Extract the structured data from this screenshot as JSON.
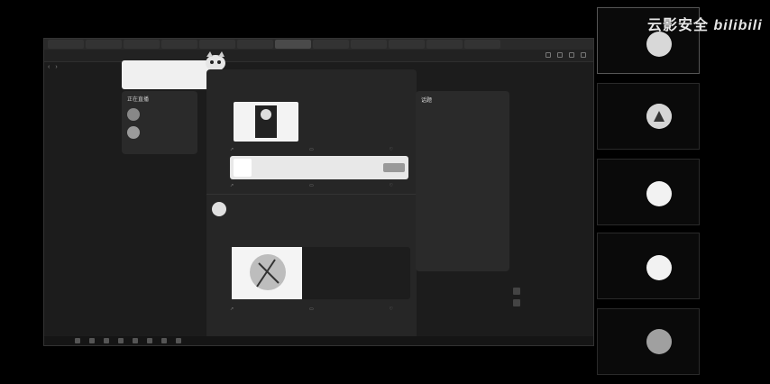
{
  "browser": {
    "tabs": [
      "",
      "",
      "",
      "",
      "",
      "",
      "",
      "",
      "",
      "",
      "",
      "",
      "",
      "",
      ""
    ],
    "tab_tooltip": ""
  },
  "search": {
    "lines": [
      "",
      ""
    ]
  },
  "follow": {
    "title": "正在直播",
    "more": "",
    "items": [
      {
        "name": "",
        "sub": ""
      },
      {
        "name": "",
        "sub": ""
      }
    ]
  },
  "feed": {
    "post1": {
      "meta": "",
      "title": "",
      "text": ""
    },
    "post2": {
      "author": "",
      "time": "",
      "text": ""
    },
    "post3": {
      "author": "",
      "text": ""
    }
  },
  "topics": {
    "title": "话题",
    "items": [
      {
        "name": "",
        "sub": ""
      },
      {
        "name": "",
        "sub": ""
      },
      {
        "name": "",
        "sub": ""
      },
      {
        "name": "",
        "sub": ""
      },
      {
        "name": "",
        "sub": ""
      },
      {
        "name": "",
        "sub": ""
      },
      {
        "name": "",
        "sub": ""
      },
      {
        "name": "",
        "sub": ""
      },
      {
        "name": "",
        "sub": ""
      }
    ]
  },
  "participants": [
    {
      "name": ""
    },
    {
      "name": ""
    },
    {
      "name": ""
    },
    {
      "name": ""
    },
    {
      "name": ""
    }
  ],
  "watermark": {
    "text": "云影安全",
    "logo": "bilibili"
  },
  "taskbar": {
    "time": ""
  }
}
